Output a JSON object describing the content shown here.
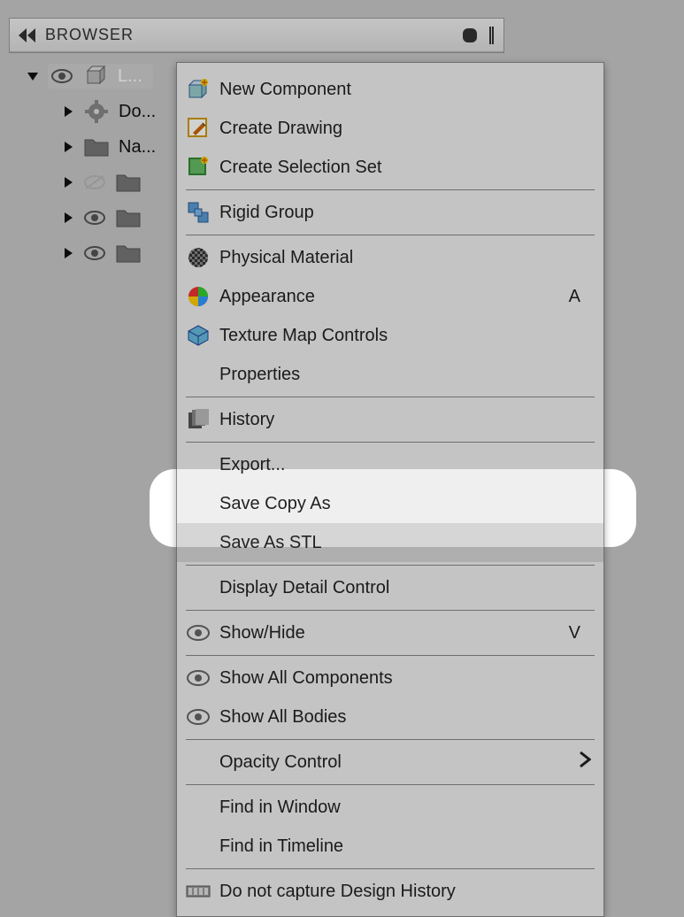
{
  "browser": {
    "title": "BROWSER",
    "tree": [
      {
        "indent": 0,
        "arrow": "down",
        "eye": "on",
        "icon": "cube",
        "label": "L...",
        "selected": true
      },
      {
        "indent": 1,
        "arrow": "right",
        "eye": null,
        "icon": "gear",
        "label": "Do..."
      },
      {
        "indent": 1,
        "arrow": "right",
        "eye": null,
        "icon": "folder",
        "label": "Na..."
      },
      {
        "indent": 1,
        "arrow": "right",
        "eye": "off",
        "icon": "folder",
        "label": ""
      },
      {
        "indent": 1,
        "arrow": "right",
        "eye": "on",
        "icon": "folder",
        "label": ""
      },
      {
        "indent": 1,
        "arrow": "right",
        "eye": "on",
        "icon": "folder",
        "label": ""
      }
    ]
  },
  "menu": {
    "items": [
      {
        "icon": "new-component",
        "label": "New Component",
        "shortcut": "",
        "hasArrow": false
      },
      {
        "icon": "create-drawing",
        "label": "Create Drawing",
        "shortcut": "",
        "hasArrow": false
      },
      {
        "icon": "selection-set",
        "label": "Create Selection Set",
        "shortcut": "",
        "hasArrow": false
      },
      {
        "sep": true
      },
      {
        "icon": "rigid-group",
        "label": "Rigid Group",
        "shortcut": "",
        "hasArrow": false
      },
      {
        "sep": true
      },
      {
        "icon": "material",
        "label": "Physical Material",
        "shortcut": "",
        "hasArrow": false
      },
      {
        "icon": "appearance",
        "label": "Appearance",
        "shortcut": "A",
        "hasArrow": false
      },
      {
        "icon": "texture",
        "label": "Texture Map Controls",
        "shortcut": "",
        "hasArrow": false
      },
      {
        "icon": "",
        "label": "Properties",
        "shortcut": "",
        "hasArrow": false
      },
      {
        "sep": true
      },
      {
        "icon": "history",
        "label": "History",
        "shortcut": "",
        "hasArrow": false
      },
      {
        "sep": true
      },
      {
        "icon": "",
        "label": "Export...",
        "shortcut": "",
        "hasArrow": false
      },
      {
        "icon": "",
        "label": "Save Copy As",
        "shortcut": "",
        "hasArrow": false
      },
      {
        "icon": "",
        "label": "Save As STL",
        "shortcut": "",
        "hasArrow": false,
        "highlighted": true
      },
      {
        "sep": true
      },
      {
        "icon": "",
        "label": "Display Detail Control",
        "shortcut": "",
        "hasArrow": false
      },
      {
        "sep": true
      },
      {
        "icon": "eye",
        "label": "Show/Hide",
        "shortcut": "V",
        "hasArrow": false
      },
      {
        "sep": true
      },
      {
        "icon": "eye",
        "label": "Show All Components",
        "shortcut": "",
        "hasArrow": false
      },
      {
        "icon": "eye",
        "label": "Show All Bodies",
        "shortcut": "",
        "hasArrow": false
      },
      {
        "sep": true
      },
      {
        "icon": "",
        "label": "Opacity Control",
        "shortcut": "",
        "hasArrow": true
      },
      {
        "sep": true
      },
      {
        "icon": "",
        "label": "Find in Window",
        "shortcut": "",
        "hasArrow": false
      },
      {
        "icon": "",
        "label": "Find in Timeline",
        "shortcut": "",
        "hasArrow": false
      },
      {
        "sep": true
      },
      {
        "icon": "timeline",
        "label": "Do not capture Design History",
        "shortcut": "",
        "hasArrow": false
      }
    ]
  }
}
